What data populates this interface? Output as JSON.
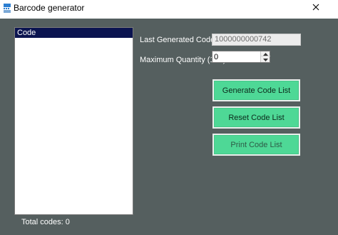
{
  "window": {
    "title": "Barcode generator",
    "close_glyph": "✕"
  },
  "list": {
    "header": "Code",
    "items": []
  },
  "form": {
    "last_code_label": "Last Generated Code",
    "last_code_value": "1000000000742",
    "max_qty_label": "Maximum Quantity (100)",
    "max_qty_value": "0"
  },
  "buttons": {
    "generate": "Generate Code List",
    "reset": "Reset Code List",
    "print": "Print Code List"
  },
  "status": {
    "total_codes": "Total codes: 0"
  },
  "colors": {
    "client_bg": "#555f5f",
    "list_header_bg": "#0b1450",
    "button_green": "#4ed896"
  },
  "icons": {
    "app": "app-icon",
    "close": "close-icon",
    "spin_up": "spin-up-icon",
    "spin_down": "spin-down-icon"
  }
}
